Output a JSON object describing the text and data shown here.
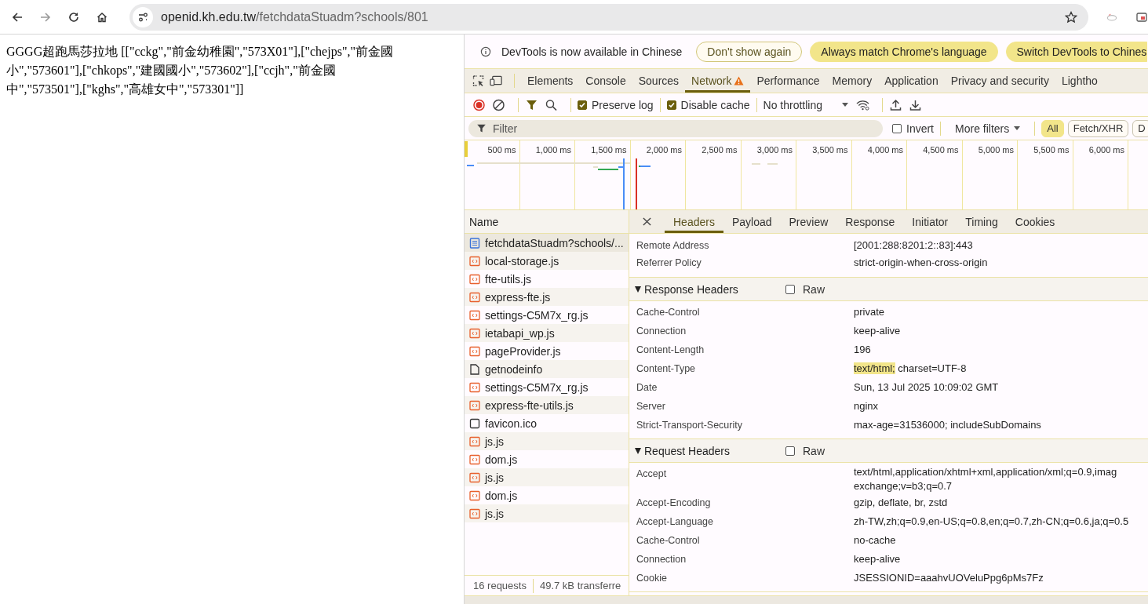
{
  "browser": {
    "url_host": "openid.kh.edu.tw",
    "url_path": "/fetchdataStuadm?schools/801"
  },
  "page": {
    "text": "GGGG超跑馬莎拉地 [[\"cckg\",\"前金幼稚園\",\"573X01\"],[\"chejps\",\"前金國小\",\"573601\"],[\"chkops\",\"建國國小\",\"573602\"],[\"ccjh\",\"前金國中\",\"573501\"],[\"kghs\",\"高雄女中\",\"573301\"]]"
  },
  "devtools": {
    "infobar": {
      "message": "DevTools is now available in Chinese",
      "buttons": [
        {
          "label": "Don't show again",
          "kind": "outline"
        },
        {
          "label": "Always match Chrome's language",
          "kind": "filled"
        },
        {
          "label": "Switch DevTools to Chines",
          "kind": "filled"
        }
      ]
    },
    "tabs": [
      {
        "label": "Elements",
        "selected": false,
        "warning": false
      },
      {
        "label": "Console",
        "selected": false,
        "warning": false
      },
      {
        "label": "Sources",
        "selected": false,
        "warning": false
      },
      {
        "label": "Network",
        "selected": true,
        "warning": true
      },
      {
        "label": "Performance",
        "selected": false,
        "warning": false
      },
      {
        "label": "Memory",
        "selected": false,
        "warning": false
      },
      {
        "label": "Application",
        "selected": false,
        "warning": false
      },
      {
        "label": "Privacy and security",
        "selected": false,
        "warning": false
      },
      {
        "label": "Lightho",
        "selected": false,
        "warning": false
      }
    ],
    "toolbar": {
      "checkboxes": [
        {
          "label": "Preserve log",
          "checked": true
        },
        {
          "label": "Disable cache",
          "checked": true
        }
      ],
      "throttling": "No throttling"
    },
    "filter": {
      "placeholder": "Filter",
      "invert": {
        "label": "Invert",
        "checked": false
      },
      "more_filters": "More filters",
      "types": [
        {
          "label": "All",
          "selected": true
        },
        {
          "label": "Fetch/XHR",
          "selected": false
        },
        {
          "label": "D",
          "selected": false
        }
      ]
    },
    "timeline": {
      "ticks": [
        "500 ms",
        "1,000 ms",
        "1,500 ms",
        "2,000 ms",
        "2,500 ms",
        "3,000 ms",
        "3,500 ms",
        "4,000 ms",
        "4,500 ms",
        "5,000 ms",
        "5,500 ms",
        "6,000 ms"
      ]
    },
    "requests": {
      "header": "Name",
      "rows": [
        {
          "name": "fetchdataStuadm?schools/...",
          "kind": "document",
          "selected": true
        },
        {
          "name": "local-storage.js",
          "kind": "script",
          "selected": false
        },
        {
          "name": "fte-utils.js",
          "kind": "script",
          "selected": false
        },
        {
          "name": "express-fte.js",
          "kind": "script",
          "selected": false
        },
        {
          "name": "settings-C5M7x_rg.js",
          "kind": "script",
          "selected": false
        },
        {
          "name": "ietabapi_wp.js",
          "kind": "script",
          "selected": false
        },
        {
          "name": "pageProvider.js",
          "kind": "script",
          "selected": false
        },
        {
          "name": "getnodeinfo",
          "kind": "file",
          "selected": false
        },
        {
          "name": "settings-C5M7x_rg.js",
          "kind": "script",
          "selected": false
        },
        {
          "name": "express-fte-utils.js",
          "kind": "script",
          "selected": false
        },
        {
          "name": "favicon.ico",
          "kind": "image",
          "selected": false
        },
        {
          "name": "js.js",
          "kind": "script",
          "selected": false
        },
        {
          "name": "dom.js",
          "kind": "script",
          "selected": false
        },
        {
          "name": "js.js",
          "kind": "script",
          "selected": false
        },
        {
          "name": "dom.js",
          "kind": "script",
          "selected": false
        },
        {
          "name": "js.js",
          "kind": "script",
          "selected": false
        }
      ]
    },
    "status": {
      "requests": "16 requests",
      "transferred": "49.7 kB transferre"
    },
    "details": {
      "tabs": [
        {
          "label": "Headers",
          "selected": true
        },
        {
          "label": "Payload",
          "selected": false
        },
        {
          "label": "Preview",
          "selected": false
        },
        {
          "label": "Response",
          "selected": false
        },
        {
          "label": "Initiator",
          "selected": false
        },
        {
          "label": "Timing",
          "selected": false
        },
        {
          "label": "Cookies",
          "selected": false
        }
      ],
      "general": [
        {
          "name": "Remote Address",
          "value": "[2001:288:8201:2::83]:443"
        },
        {
          "name": "Referrer Policy",
          "value": "strict-origin-when-cross-origin"
        }
      ],
      "sections": [
        {
          "title": "Response Headers",
          "expanded": true,
          "raw": {
            "label": "Raw",
            "checked": false
          },
          "rows": [
            {
              "name": "Cache-Control",
              "value": "private"
            },
            {
              "name": "Connection",
              "value": "keep-alive"
            },
            {
              "name": "Content-Length",
              "value": "196"
            },
            {
              "name": "Content-Type",
              "highlight": "text/html;",
              "value": "charset=UTF-8"
            },
            {
              "name": "Date",
              "value": "Sun, 13 Jul 2025 10:09:02 GMT"
            },
            {
              "name": "Server",
              "value": "nginx"
            },
            {
              "name": "Strict-Transport-Security",
              "value": "max-age=31536000; includeSubDomains"
            }
          ]
        },
        {
          "title": "Request Headers",
          "expanded": true,
          "raw": {
            "label": "Raw",
            "checked": false
          },
          "rows": [
            {
              "name": "Accept",
              "lines": [
                "text/html,application/xhtml+xml,application/xml;q=0.9,imag",
                "exchange;v=b3;q=0.7"
              ]
            },
            {
              "name": "Accept-Encoding",
              "value": "gzip, deflate, br, zstd"
            },
            {
              "name": "Accept-Language",
              "value": "zh-TW,zh;q=0.9,en-US;q=0.8,en;q=0.7,zh-CN;q=0.6,ja;q=0.5"
            },
            {
              "name": "Cache-Control",
              "value": "no-cache"
            },
            {
              "name": "Connection",
              "value": "keep-alive"
            },
            {
              "name": "Cookie",
              "value": "JSESSIONID=aaahvUOVeluPpg6pMs7Fz"
            }
          ]
        }
      ]
    }
  }
}
